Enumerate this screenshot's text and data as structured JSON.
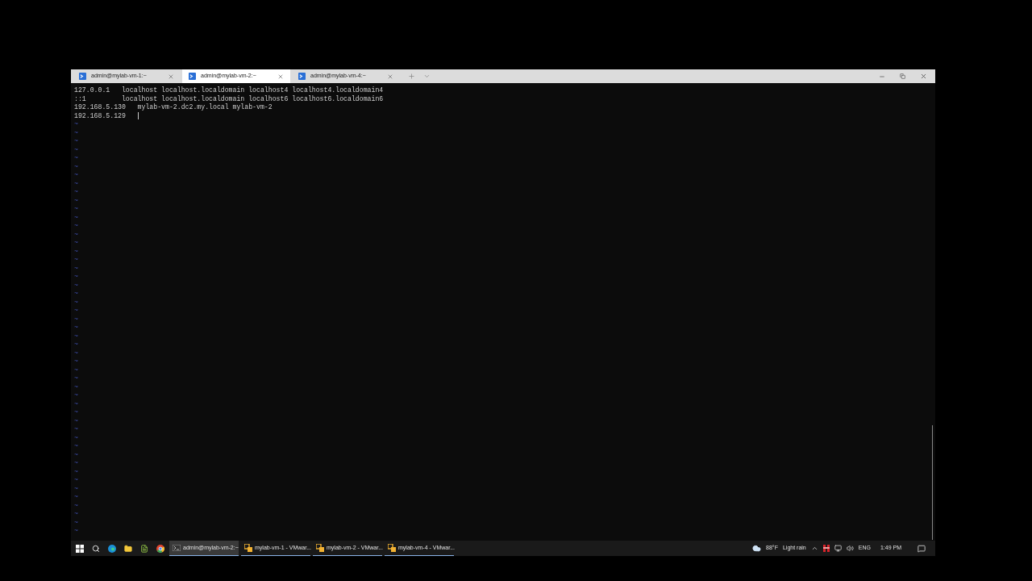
{
  "tabs": [
    {
      "title": "admin@mylab-vm-1:~",
      "selected": false
    },
    {
      "title": "admin@mylab-vm-2:~",
      "selected": true
    },
    {
      "title": "admin@mylab-vm-4:~",
      "selected": false
    }
  ],
  "terminal": {
    "lines": [
      "127.0.0.1   localhost localhost.localdomain localhost4 localhost4.localdomain4",
      "::1         localhost localhost.localdomain localhost6 localhost6.localdomain6",
      "192.168.5.130   mylab-vm-2.dc2.my.local mylab-vm-2",
      "192.168.5.129   "
    ],
    "empty_line_markers": [
      "~",
      "~",
      "~",
      "~",
      "~",
      "~",
      "~",
      "~",
      "~",
      "~",
      "~",
      "~",
      "~",
      "~",
      "~",
      "~",
      "~",
      "~",
      "~",
      "~",
      "~",
      "~",
      "~",
      "~",
      "~",
      "~",
      "~",
      "~",
      "~",
      "~",
      "~",
      "~",
      "~",
      "~",
      "~",
      "~",
      "~",
      "~",
      "~",
      "~",
      "~",
      "~",
      "~",
      "~",
      "~",
      "~",
      "~",
      "~",
      "~"
    ]
  },
  "taskbar": {
    "tasks": [
      {
        "kind": "terminal",
        "label": "admin@mylab-vm-2:~",
        "selected": true
      },
      {
        "kind": "vm",
        "label": "mylab-vm-1 - VMwar...",
        "selected": false
      },
      {
        "kind": "vm",
        "label": "mylab-vm-2 - VMwar...",
        "selected": false
      },
      {
        "kind": "vm",
        "label": "mylab-vm-4 - VMwar...",
        "selected": false
      }
    ],
    "weather": {
      "temperature": "88°F",
      "condition": "Light rain"
    },
    "language": "ENG",
    "time": "1:49 PM"
  }
}
